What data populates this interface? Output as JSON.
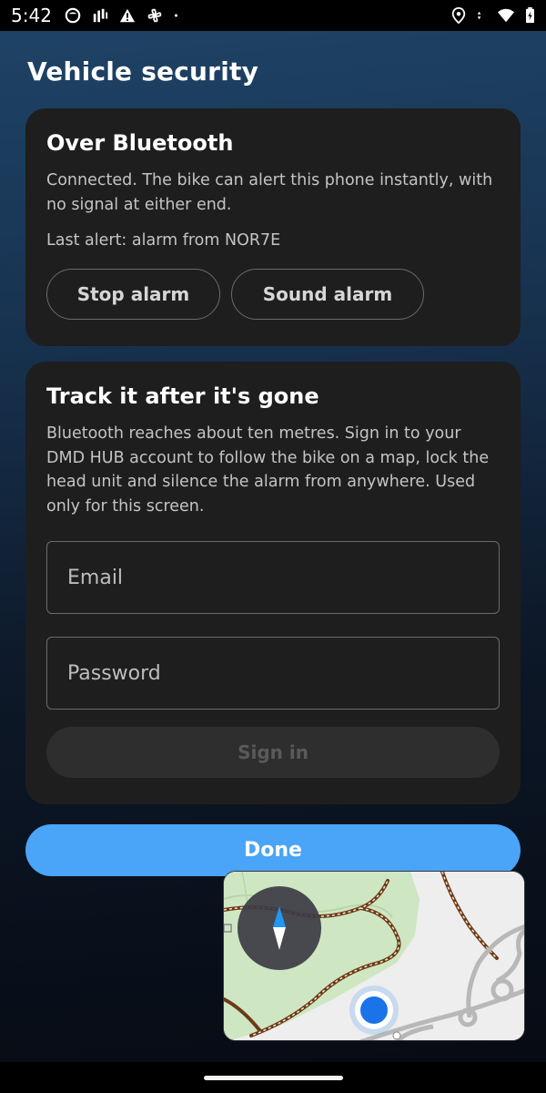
{
  "status_bar": {
    "time": "5:42",
    "left_icons": [
      "face-icon",
      "signal-bars-icon",
      "warning-icon",
      "pinwheel-icon",
      "dot-icon"
    ],
    "right_icons": [
      "location-icon",
      "data-arrows-icon",
      "wifi-icon",
      "battery-icon"
    ]
  },
  "page": {
    "title": "Vehicle security"
  },
  "bluetooth_card": {
    "heading": "Over Bluetooth",
    "description": "Connected. The bike can alert this phone instantly, with no signal at either end.",
    "last_alert": "Last alert: alarm from NOR7E",
    "stop_alarm_label": "Stop alarm",
    "sound_alarm_label": "Sound alarm"
  },
  "track_card": {
    "heading": "Track it after it's gone",
    "description": "Bluetooth reaches about ten metres. Sign in to your DMD HUB account to follow the bike on a map, lock the head unit and silence the alarm from anywhere. Used only for this screen.",
    "email_placeholder": "Email",
    "email_value": "",
    "password_placeholder": "Password",
    "password_value": "",
    "sign_in_label": "Sign in",
    "sign_in_enabled": false
  },
  "done_label": "Done",
  "map_preview": {
    "icons": [
      "compass-icon",
      "location-dot-icon"
    ]
  },
  "colors": {
    "accent": "#4aa4f7",
    "card_background": "#1e1e1e",
    "compass_north": "#2196f3",
    "location_dot": "#1a73e8"
  }
}
